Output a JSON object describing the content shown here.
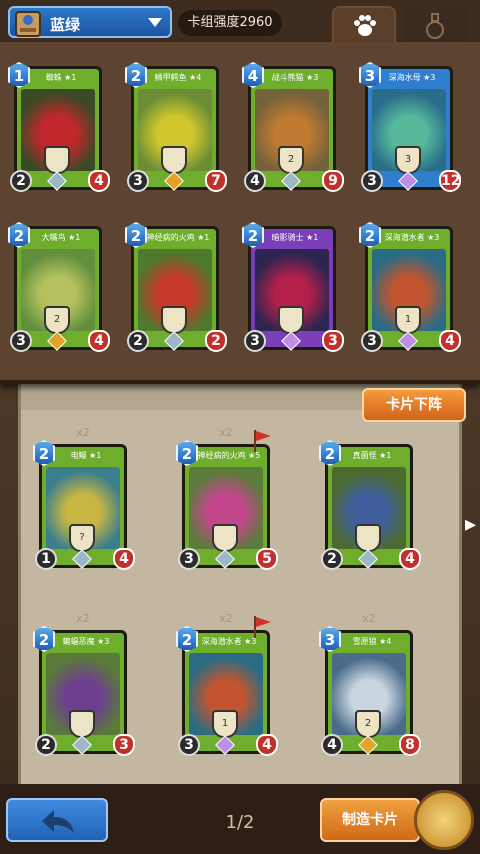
{
  "topbar": {
    "deck_name": "蓝绿",
    "strength_label": "卡组强度2960",
    "icons": [
      "paw-icon",
      "potion-icon"
    ]
  },
  "deck_cards": [
    {
      "title": "蜘蛛 ★1",
      "cost": "1",
      "atk": "2",
      "hp": "4",
      "frame": "#6fae2c",
      "gem": "#9db7c8",
      "art": [
        "#3a4a24",
        "#c2272c"
      ],
      "ability": ""
    },
    {
      "title": "鳞甲鳄鱼 ★4",
      "cost": "2",
      "atk": "3",
      "hp": "7",
      "frame": "#6fae2c",
      "gem": "#e3a329",
      "art": [
        "#6c8d36",
        "#d1c72d"
      ],
      "ability": ""
    },
    {
      "title": "战斗熊猫 ★3",
      "cost": "4",
      "atk": "4",
      "hp": "9",
      "frame": "#6fae2c",
      "gem": "#9db7c8",
      "art": [
        "#74623b",
        "#c07a32"
      ],
      "ability": "2"
    },
    {
      "title": "深海水母 ★3",
      "cost": "3",
      "atk": "3",
      "hp": "12",
      "frame": "#2f7ed0",
      "gem": "#c08ee6",
      "art": [
        "#2a6d8a",
        "#56b99b"
      ],
      "ability": "3"
    },
    {
      "title": "大嘴鸟 ★1",
      "cost": "2",
      "atk": "3",
      "hp": "4",
      "frame": "#6fae2c",
      "gem": "#e3a329",
      "art": [
        "#628f3d",
        "#b4c15e"
      ],
      "ability": "2"
    },
    {
      "title": "神经病的火鸡 ★1",
      "cost": "2",
      "atk": "2",
      "hp": "2",
      "frame": "#6fae2c",
      "gem": "#9db7c8",
      "art": [
        "#4d7a2d",
        "#c7392a"
      ],
      "ability": ""
    },
    {
      "title": "暗影骑士 ★1",
      "cost": "2",
      "atk": "3",
      "hp": "3",
      "frame": "#7a3fb8",
      "gem": "#c08ee6",
      "art": [
        "#2c2550",
        "#b3204a"
      ],
      "ability": ""
    },
    {
      "title": "深海潜水者 ★3",
      "cost": "2",
      "atk": "3",
      "hp": "4",
      "frame": "#6fae2c",
      "gem": "#c08ee6",
      "art": [
        "#2a6c84",
        "#c2552f"
      ],
      "ability": "1"
    }
  ],
  "collection_cards": [
    {
      "copies": "x2",
      "title": "电鳗 ★1",
      "cost": "2",
      "atk": "1",
      "hp": "4",
      "frame": "#6fae2c",
      "gem": "#9db7c8",
      "art": [
        "#3c7f8c",
        "#c8b642"
      ],
      "ability": "?",
      "flag": false
    },
    {
      "copies": "x2",
      "title": "神经病的火鸡 ★5",
      "cost": "2",
      "atk": "3",
      "hp": "5",
      "frame": "#6fae2c",
      "gem": "#9db7c8",
      "art": [
        "#5b7b3a",
        "#c4478d"
      ],
      "ability": "",
      "flag": true
    },
    {
      "copies": "",
      "title": "真菌怪 ★1",
      "cost": "2",
      "atk": "2",
      "hp": "4",
      "frame": "#6fae2c",
      "gem": "#9db7c8",
      "art": [
        "#4b6b2f",
        "#3f5e9c"
      ],
      "ability": "",
      "flag": false
    },
    {
      "copies": "x2",
      "title": "蝙蝠恶魔 ★3",
      "cost": "2",
      "atk": "2",
      "hp": "3",
      "frame": "#6fae2c",
      "gem": "#9db7c8",
      "art": [
        "#5a7a3a",
        "#6d3f8f"
      ],
      "ability": "",
      "flag": false
    },
    {
      "copies": "x2",
      "title": "深海潜水者 ★3",
      "cost": "2",
      "atk": "3",
      "hp": "4",
      "frame": "#6fae2c",
      "gem": "#c08ee6",
      "art": [
        "#2a6c84",
        "#c2552f"
      ],
      "ability": "1",
      "flag": true
    },
    {
      "copies": "x2",
      "title": "雪原狼 ★4",
      "cost": "3",
      "atk": "4",
      "hp": "8",
      "frame": "#6fae2c",
      "gem": "#e3a329",
      "art": [
        "#4a6c8a",
        "#c9d6e0"
      ],
      "ability": "2",
      "flag": false
    }
  ],
  "remove_button": "卡片下阵",
  "footer": {
    "page_indicator": "1/2",
    "craft_label": "制造卡片"
  }
}
